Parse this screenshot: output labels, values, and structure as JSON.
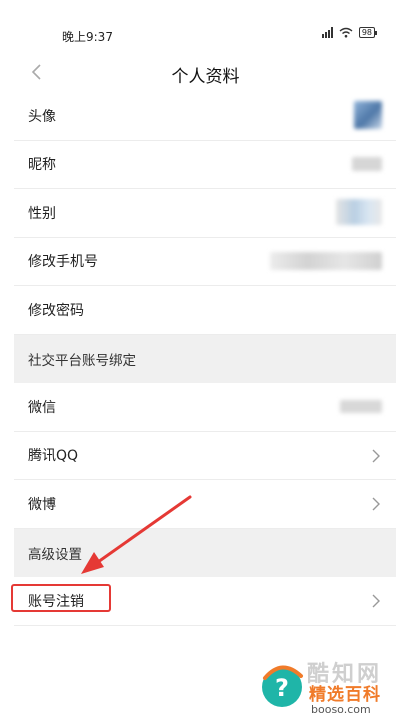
{
  "status_bar": {
    "time": "晚上9:37",
    "battery": "98"
  },
  "header": {
    "title": "个人资料"
  },
  "rows": {
    "avatar": "头像",
    "nickname": "昵称",
    "gender": "性别",
    "change_phone": "修改手机号",
    "change_password": "修改密码",
    "social_section": "社交平台账号绑定",
    "wechat": "微信",
    "tencent_qq": "腾讯QQ",
    "weibo": "微博",
    "advanced_section": "高级设置",
    "account_cancel": "账号注销"
  },
  "watermark": {
    "ghost_text": "酷知网",
    "brand": "精选百科",
    "url": "booso.com"
  },
  "colors": {
    "highlight_red": "#e53935",
    "section_bg": "#f0f0f0",
    "watermark_orange": "#f07b2a",
    "watermark_teal": "#1fb5a8"
  }
}
